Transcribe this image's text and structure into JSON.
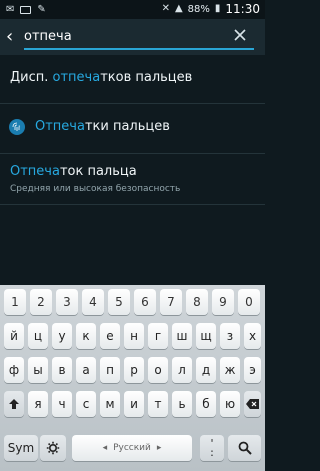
{
  "statusbar": {
    "battery": "88%",
    "time": "11:30"
  },
  "search": {
    "query": "отпеча"
  },
  "results": [
    {
      "title_parts": [
        "Дисп. ",
        "отпеча",
        "тков пальцев"
      ]
    },
    {
      "title_parts": [
        "",
        "Отпеча",
        "тки пальцев"
      ]
    },
    {
      "title_parts": [
        "",
        "Отпеча",
        "ток пальца"
      ],
      "subtitle": "Средняя или высокая безопасность"
    }
  ],
  "keyboard": {
    "numbers": [
      "1",
      "2",
      "3",
      "4",
      "5",
      "6",
      "7",
      "8",
      "9",
      "0"
    ],
    "row1": [
      "й",
      "ц",
      "у",
      "к",
      "е",
      "н",
      "г",
      "ш",
      "щ",
      "з",
      "х"
    ],
    "row2": [
      "ф",
      "ы",
      "в",
      "а",
      "п",
      "р",
      "о",
      "л",
      "д",
      "ж",
      "э"
    ],
    "row3": [
      "я",
      "ч",
      "с",
      "м",
      "и",
      "т",
      "ь",
      "б",
      "ю"
    ],
    "sym": "Sym",
    "space_label": "Русский",
    "punct_top": "'",
    "punct_bottom": ":",
    "icons": [
      "shift-icon",
      "backspace-icon",
      "settings-icon",
      "search-icon"
    ]
  },
  "colors": {
    "accent": "#27a9e0",
    "background": "#0f1a1f"
  }
}
